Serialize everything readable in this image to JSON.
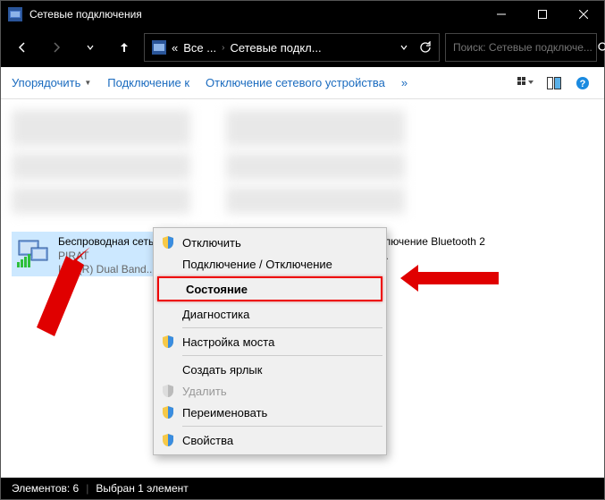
{
  "title": "Сетевые подключения",
  "breadcrumb": {
    "seg1": "Все ...",
    "seg2": "Сетевые подкл..."
  },
  "chev": "›",
  "search": {
    "placeholder": "Поиск: Сетевые подключе..."
  },
  "toolbar": {
    "organize": "Упорядочить",
    "connect": "Подключение к",
    "disconnect": "Отключение сетевого устройства",
    "more": "»"
  },
  "connections": {
    "wifi": {
      "name": "Беспроводная сеть 2",
      "ssid": "PIRAT",
      "adapter": "Intel(R) Dual Band..."
    },
    "bt": {
      "name": "Сетевое подключение Bluetooth 2",
      "adapter": "...sonal Area ..."
    }
  },
  "ctx": {
    "disable": "Отключить",
    "connect_disconnect": "Подключение / Отключение",
    "status": "Состояние",
    "diag": "Диагностика",
    "bridge": "Настройка моста",
    "shortcut": "Создать ярлык",
    "delete": "Удалить",
    "rename": "Переименовать",
    "properties": "Свойства"
  },
  "status": {
    "count": "Элементов: 6",
    "selected": "Выбран 1 элемент"
  }
}
